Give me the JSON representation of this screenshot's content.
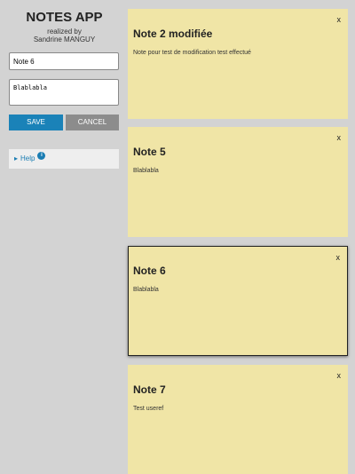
{
  "app": {
    "title": "NOTES APP",
    "subtitle": "realized by",
    "author": "Sandrine MANGUY"
  },
  "form": {
    "title_value": "Note 6",
    "content_value": "Blablabla",
    "save_label": "SAVE",
    "cancel_label": "CANCEL"
  },
  "help": {
    "label": "Help",
    "badge": "i",
    "arrow": "▸"
  },
  "notes": [
    {
      "title": "Note 2 modifiée",
      "body": "Note pour test de modification test effectué",
      "close": "x"
    },
    {
      "title": "Note 5",
      "body": "Blablabla",
      "close": "x"
    },
    {
      "title": "Note 6",
      "body": "Blablabla",
      "close": "x"
    },
    {
      "title": "Note 7",
      "body": "Test useref",
      "close": "x"
    }
  ],
  "colors": {
    "background": "#d3d3d3",
    "note": "#f0e5a6",
    "save": "#1a82b8",
    "cancel": "#8c8c8c",
    "link": "#1a7db3"
  }
}
